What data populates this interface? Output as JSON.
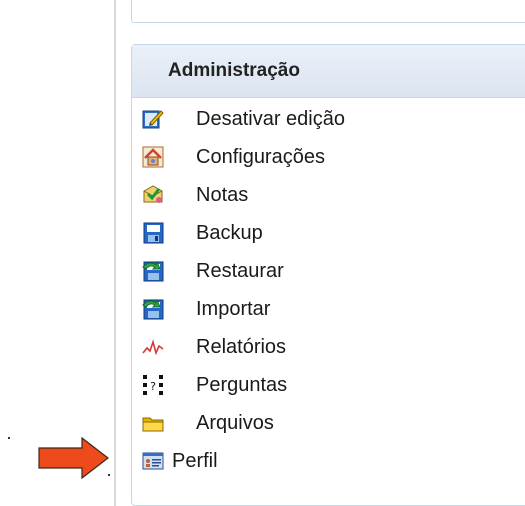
{
  "block": {
    "title": "Administração",
    "items": [
      {
        "label": "Desativar edição",
        "icon": "edit-icon"
      },
      {
        "label": "Configurações",
        "icon": "settings-icon"
      },
      {
        "label": "Notas",
        "icon": "grades-icon"
      },
      {
        "label": "Backup",
        "icon": "backup-icon"
      },
      {
        "label": "Restaurar",
        "icon": "restore-icon"
      },
      {
        "label": "Importar",
        "icon": "import-icon"
      },
      {
        "label": "Relatórios",
        "icon": "reports-icon"
      },
      {
        "label": "Perguntas",
        "icon": "questions-icon"
      },
      {
        "label": "Arquivos",
        "icon": "folder-icon"
      },
      {
        "label": "Perfil",
        "icon": "profile-icon"
      }
    ]
  },
  "colors": {
    "arrow_fill": "#ee4a1b",
    "header_bg": "#dbe4f0",
    "border": "#c7d7ea"
  }
}
